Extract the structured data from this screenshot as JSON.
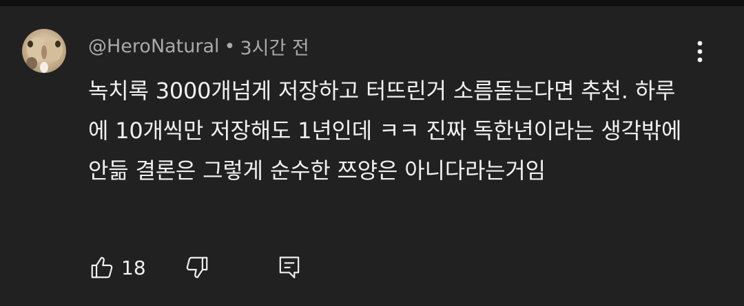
{
  "comment": {
    "author": "@HeroNatural",
    "separator": "•",
    "timestamp": "3시간 전",
    "text": "녹치록 3000개넘게 저장하고 터뜨린거 소름돋는다면 추천. 하루에 10개씩만 저장해도 1년인데 ㅋㅋ 진짜 독한년이라는 생각밖에 안듦 결론은 그렇게 순수한 쯔양은 아니다라는거임",
    "like_count": "18"
  },
  "icons": {
    "more": "more-vert-icon",
    "like": "thumb-up-icon",
    "dislike": "thumb-down-icon",
    "reply": "reply-comment-icon"
  },
  "colors": {
    "background": "#212121",
    "divider": "#0f0f0f",
    "primary_text": "#f1f1f1",
    "secondary_text": "#aaaaaa"
  }
}
